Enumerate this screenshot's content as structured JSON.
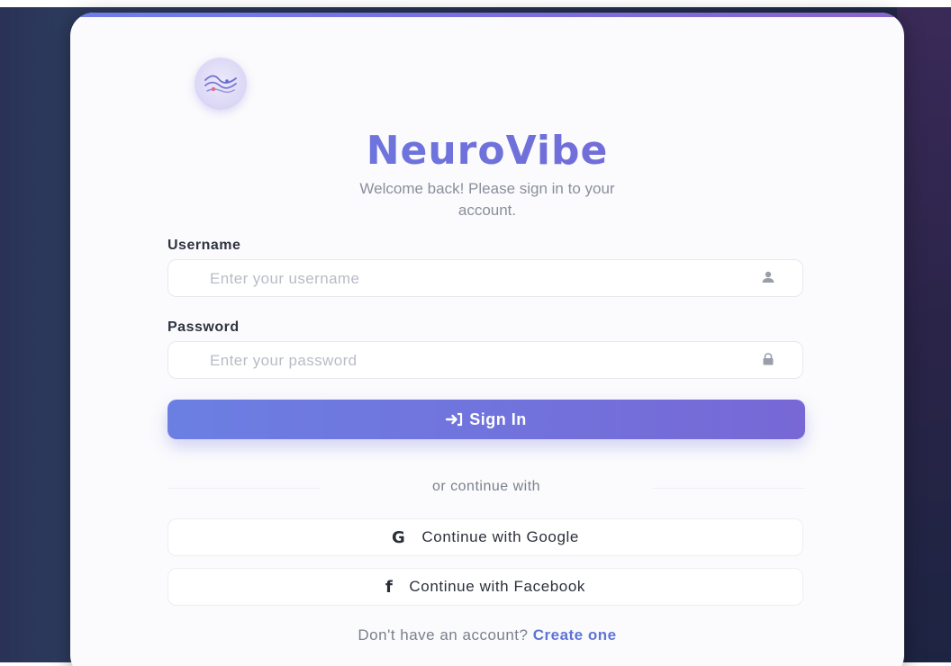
{
  "brand": {
    "name": "NeuroVibe",
    "subtitle_line1": "Welcome back! Please sign in to your",
    "subtitle_line2": "account."
  },
  "form": {
    "username_label": "Username",
    "username_placeholder": "Enter your username",
    "password_label": "Password",
    "password_placeholder": "Enter your password",
    "signin_label": "Sign In"
  },
  "divider_text": "or continue with",
  "social": {
    "google_icon": "G",
    "google_label": "Continue with Google",
    "facebook_icon": "f",
    "facebook_label": "Continue with Facebook"
  },
  "footer": {
    "prompt": "Don't have an account?",
    "link": "Create one"
  },
  "colors": {
    "accent": "#6c73dd",
    "accent_end": "#7767d6",
    "link": "#5e74d8",
    "backdrop": "#26304f"
  },
  "icons": {
    "logo": "brain-wave-logo-icon",
    "username": "user-icon",
    "password": "lock-icon",
    "signin": "sign-in-arrow-icon"
  }
}
